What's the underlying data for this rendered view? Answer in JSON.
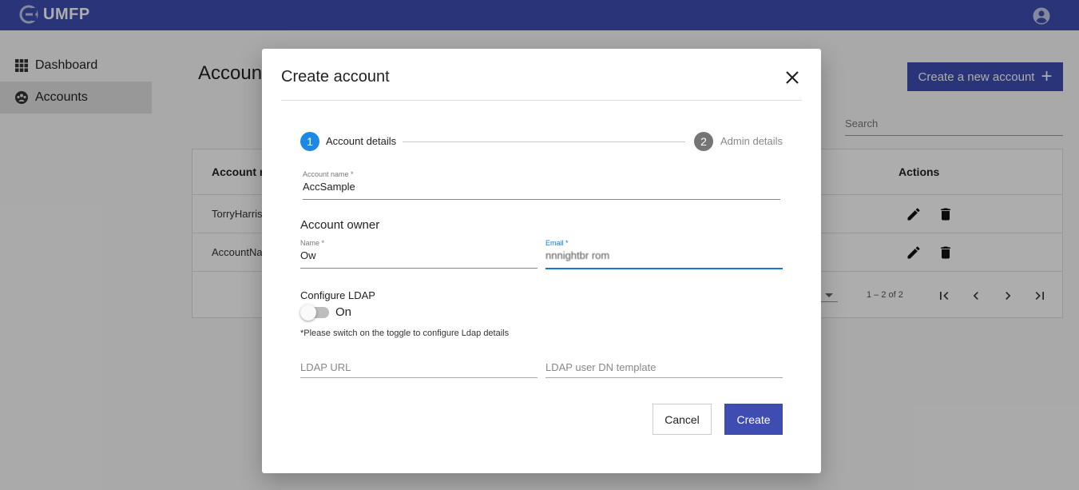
{
  "app": {
    "name": "UMFP"
  },
  "sidebar": {
    "items": [
      {
        "label": "Dashboard",
        "icon": "grid-icon"
      },
      {
        "label": "Accounts",
        "icon": "account-group-icon",
        "active": true
      }
    ]
  },
  "main": {
    "title": "Accounts",
    "create_button": "Create a new account",
    "search_placeholder": "Search",
    "table": {
      "headers": [
        "Account n",
        "Actions"
      ],
      "rows": [
        {
          "name": "TorryHarris"
        },
        {
          "name": "AccountNa"
        }
      ],
      "paginator": {
        "range": "1 – 2 of 2"
      }
    }
  },
  "dialog": {
    "title": "Create account",
    "steps": [
      {
        "number": "1",
        "label": "Account details",
        "active": true
      },
      {
        "number": "2",
        "label": "Admin details",
        "active": false
      }
    ],
    "account_name": {
      "label": "Account name *",
      "value": "AccSample"
    },
    "owner_section": "Account owner",
    "owner_name": {
      "label": "Name *",
      "value": "Ow"
    },
    "owner_email": {
      "label": "Email *",
      "value": "nnnightbr  rom"
    },
    "ldap": {
      "heading": "Configure LDAP",
      "toggle_label": "On",
      "toggle_on": false,
      "note": "*Please switch on the toggle to configure Ldap details",
      "url_placeholder": "LDAP URL",
      "dn_placeholder": "LDAP user DN template"
    },
    "buttons": {
      "cancel": "Cancel",
      "create": "Create"
    }
  },
  "colors": {
    "primary": "#3f4db3",
    "accent": "#1976d2",
    "step_inactive": "#757575"
  }
}
